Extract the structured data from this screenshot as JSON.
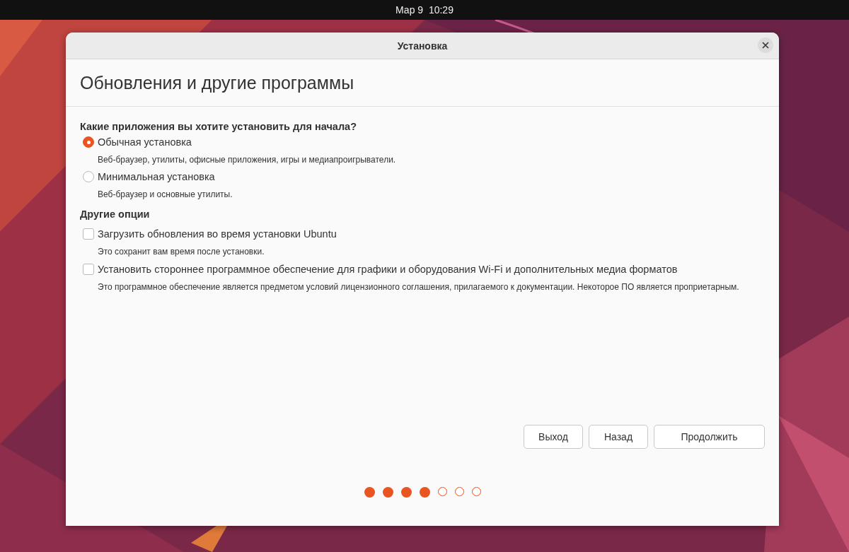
{
  "top_bar": {
    "clock": "Мар 9  10:29"
  },
  "window": {
    "title": "Установка"
  },
  "page": {
    "heading": "Обновления и другие программы",
    "question": "Какие приложения вы хотите установить для начала?",
    "install_types": [
      {
        "label": "Обычная установка",
        "description": "Веб-браузер, утилиты, офисные приложения, игры и медиапроигрыватели.",
        "selected": true
      },
      {
        "label": "Минимальная установка",
        "description": "Веб-браузер и основные утилиты.",
        "selected": false
      }
    ],
    "other_heading": "Другие опции",
    "options": [
      {
        "label": "Загрузить обновления во время установки Ubuntu",
        "description": "Это сохранит вам время после установки.",
        "checked": false
      },
      {
        "label": "Установить стороннее программное обеспечение для графики и оборудования Wi-Fi и дополнительных медиа форматов",
        "description": "Это программное обеспечение является предметом условий лицензионного соглашения, прилагаемого к документации. Некоторое ПО является проприетарным.",
        "checked": false
      }
    ]
  },
  "buttons": [
    "Выход",
    "Назад",
    "Продолжить"
  ],
  "progress": [
    {
      "done": true
    },
    {
      "done": true
    },
    {
      "done": true
    },
    {
      "done": true
    },
    {
      "done": false
    },
    {
      "done": false
    },
    {
      "done": false
    }
  ]
}
